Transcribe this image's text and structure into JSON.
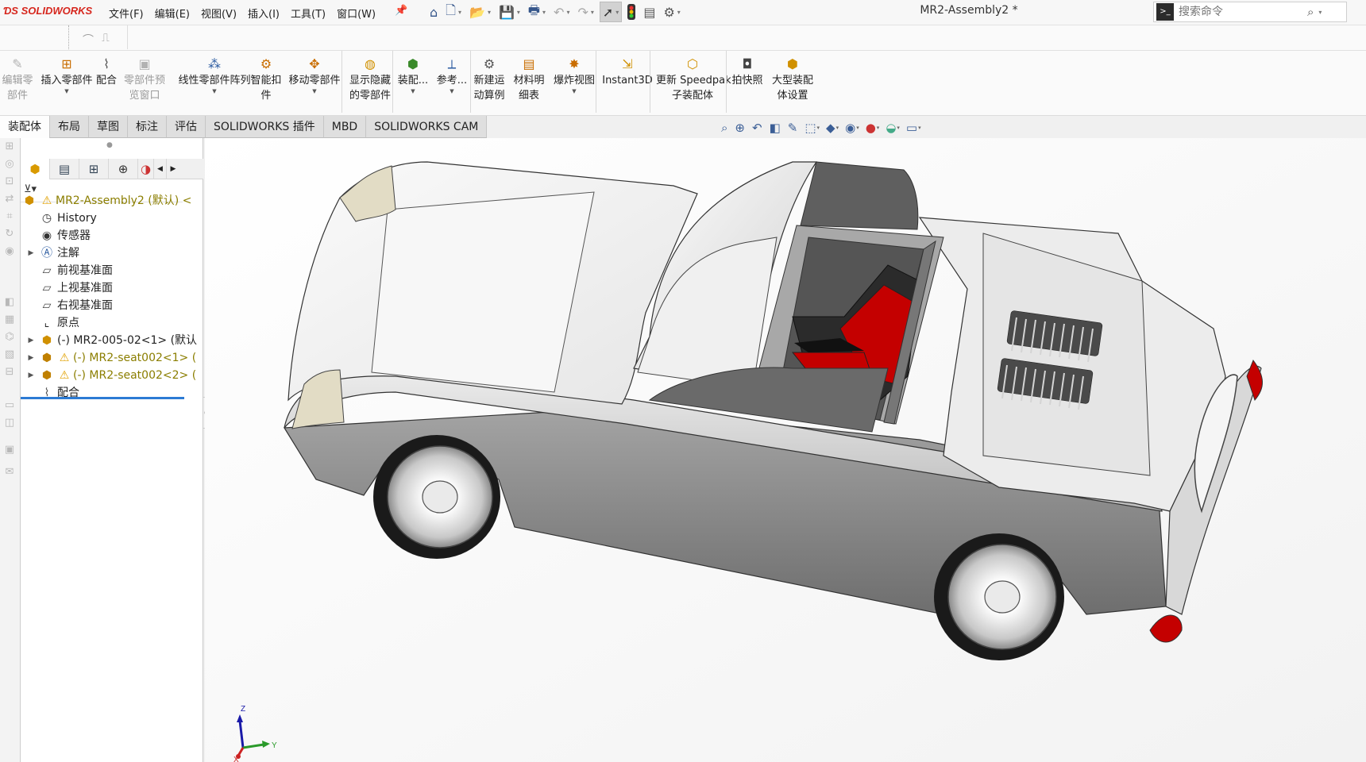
{
  "app": {
    "logo": "SOLIDWORKS",
    "document_title": "MR2-Assembly2 *"
  },
  "menu": [
    "文件(F)",
    "编辑(E)",
    "视图(V)",
    "插入(I)",
    "工具(T)",
    "窗口(W)"
  ],
  "quick_access": [
    {
      "icon": "home-icon"
    },
    {
      "icon": "new-document-icon"
    },
    {
      "icon": "open-folder-icon"
    },
    {
      "icon": "save-icon"
    },
    {
      "icon": "print-icon"
    },
    {
      "icon": "undo-icon"
    },
    {
      "icon": "redo-icon"
    },
    {
      "icon": "select-cursor-icon"
    },
    {
      "icon": "rebuild-traffic-light-icon"
    },
    {
      "icon": "file-properties-icon"
    },
    {
      "icon": "options-gear-icon"
    }
  ],
  "search": {
    "placeholder": "搜索命令"
  },
  "command_manager": [
    {
      "label": "编辑零\n部件",
      "icon": "edit-component-icon",
      "disabled": true,
      "dropdown": false
    },
    {
      "label": "插入零部件",
      "icon": "insert-components-icon",
      "disabled": false,
      "dropdown": true
    },
    {
      "label": "配合",
      "icon": "mate-paperclip-icon",
      "disabled": false,
      "dropdown": false
    },
    {
      "label": "零部件预\n览窗口",
      "icon": "component-preview-icon",
      "disabled": true,
      "dropdown": false
    },
    {
      "label": "线性零部件阵列",
      "icon": "linear-pattern-icon",
      "disabled": false,
      "dropdown": true
    },
    {
      "label": "智能扣\n件",
      "icon": "smart-fasteners-icon",
      "disabled": false,
      "dropdown": false
    },
    {
      "label": "移动零部件",
      "icon": "move-component-icon",
      "disabled": false,
      "dropdown": true
    },
    {
      "label": "显示隐藏\n的零部件",
      "icon": "show-hidden-components-icon",
      "disabled": false,
      "dropdown": false
    },
    {
      "label": "装配...",
      "icon": "assembly-features-icon",
      "disabled": false,
      "dropdown": true
    },
    {
      "label": "参考...",
      "icon": "reference-geometry-icon",
      "disabled": false,
      "dropdown": true
    },
    {
      "label": "新建运\n动算例",
      "icon": "new-motion-study-icon",
      "disabled": false,
      "dropdown": false
    },
    {
      "label": "材料明\n细表",
      "icon": "bill-of-materials-icon",
      "disabled": false,
      "dropdown": false
    },
    {
      "label": "爆炸视图",
      "icon": "exploded-view-icon",
      "disabled": false,
      "dropdown": true
    },
    {
      "label": "Instant3D",
      "icon": "instant3d-icon",
      "disabled": false,
      "dropdown": false
    },
    {
      "label": "更新 Speedpak\n子装配体",
      "icon": "update-speedpak-icon",
      "disabled": false,
      "dropdown": false
    },
    {
      "label": "拍快照",
      "icon": "snapshot-camera-icon",
      "disabled": false,
      "dropdown": false
    },
    {
      "label": "大型装配\n体设置",
      "icon": "large-assembly-settings-icon",
      "disabled": false,
      "dropdown": false
    }
  ],
  "tabs": [
    "装配体",
    "布局",
    "草图",
    "标注",
    "评估",
    "SOLIDWORKS 插件",
    "MBD",
    "SOLIDWORKS CAM"
  ],
  "active_tab": "装配体",
  "heads_up": [
    "zoom-to-fit-icon",
    "zoom-area-icon",
    "previous-view-icon",
    "section-view-icon",
    "dynamic-annotation-icon",
    "view-orientation-icon",
    "display-style-icon",
    "hide-show-items-icon",
    "edit-appearance-icon",
    "apply-scene-icon",
    "view-settings-icon"
  ],
  "feature_tree": [
    {
      "text": "MR2-Assembly2 (默认) <",
      "icon": "assembly-icon",
      "warn": true,
      "twisty": false,
      "indent": 0,
      "color": "#8b7e00"
    },
    {
      "text": "History",
      "icon": "history-icon",
      "warn": false,
      "twisty": false,
      "indent": 1,
      "color": "#222"
    },
    {
      "text": "传感器",
      "icon": "sensor-icon",
      "warn": false,
      "twisty": false,
      "indent": 1,
      "color": "#222"
    },
    {
      "text": "注解",
      "icon": "annotations-icon",
      "warn": false,
      "twisty": true,
      "indent": 1,
      "color": "#222"
    },
    {
      "text": "前视基准面",
      "icon": "plane-icon",
      "warn": false,
      "twisty": false,
      "indent": 1,
      "color": "#222"
    },
    {
      "text": "上视基准面",
      "icon": "plane-icon",
      "warn": false,
      "twisty": false,
      "indent": 1,
      "color": "#222"
    },
    {
      "text": "右视基准面",
      "icon": "plane-icon",
      "warn": false,
      "twisty": false,
      "indent": 1,
      "color": "#222"
    },
    {
      "text": "原点",
      "icon": "origin-icon",
      "warn": false,
      "twisty": false,
      "indent": 1,
      "color": "#222"
    },
    {
      "text": "(-) MR2-005-02<1> (默认",
      "icon": "part-icon",
      "warn": false,
      "twisty": true,
      "indent": 1,
      "color": "#222"
    },
    {
      "text": "(-) MR2-seat002<1> (",
      "icon": "subassembly-icon",
      "warn": true,
      "twisty": true,
      "indent": 1,
      "color": "#8b7e00"
    },
    {
      "text": "(-) MR2-seat002<2> (",
      "icon": "subassembly-icon",
      "warn": true,
      "twisty": true,
      "indent": 1,
      "color": "#8b7e00"
    },
    {
      "text": "配合",
      "icon": "mates-icon",
      "warn": false,
      "twisty": false,
      "indent": 1,
      "color": "#222"
    }
  ],
  "triad": {
    "x_label": "X",
    "y_label": "Y",
    "z_label": "Z"
  },
  "colors": {
    "accent_red": "#d6261d",
    "selection_blue": "#2c7bd4",
    "seat_red": "#c40000",
    "warning": "#e1a100"
  }
}
